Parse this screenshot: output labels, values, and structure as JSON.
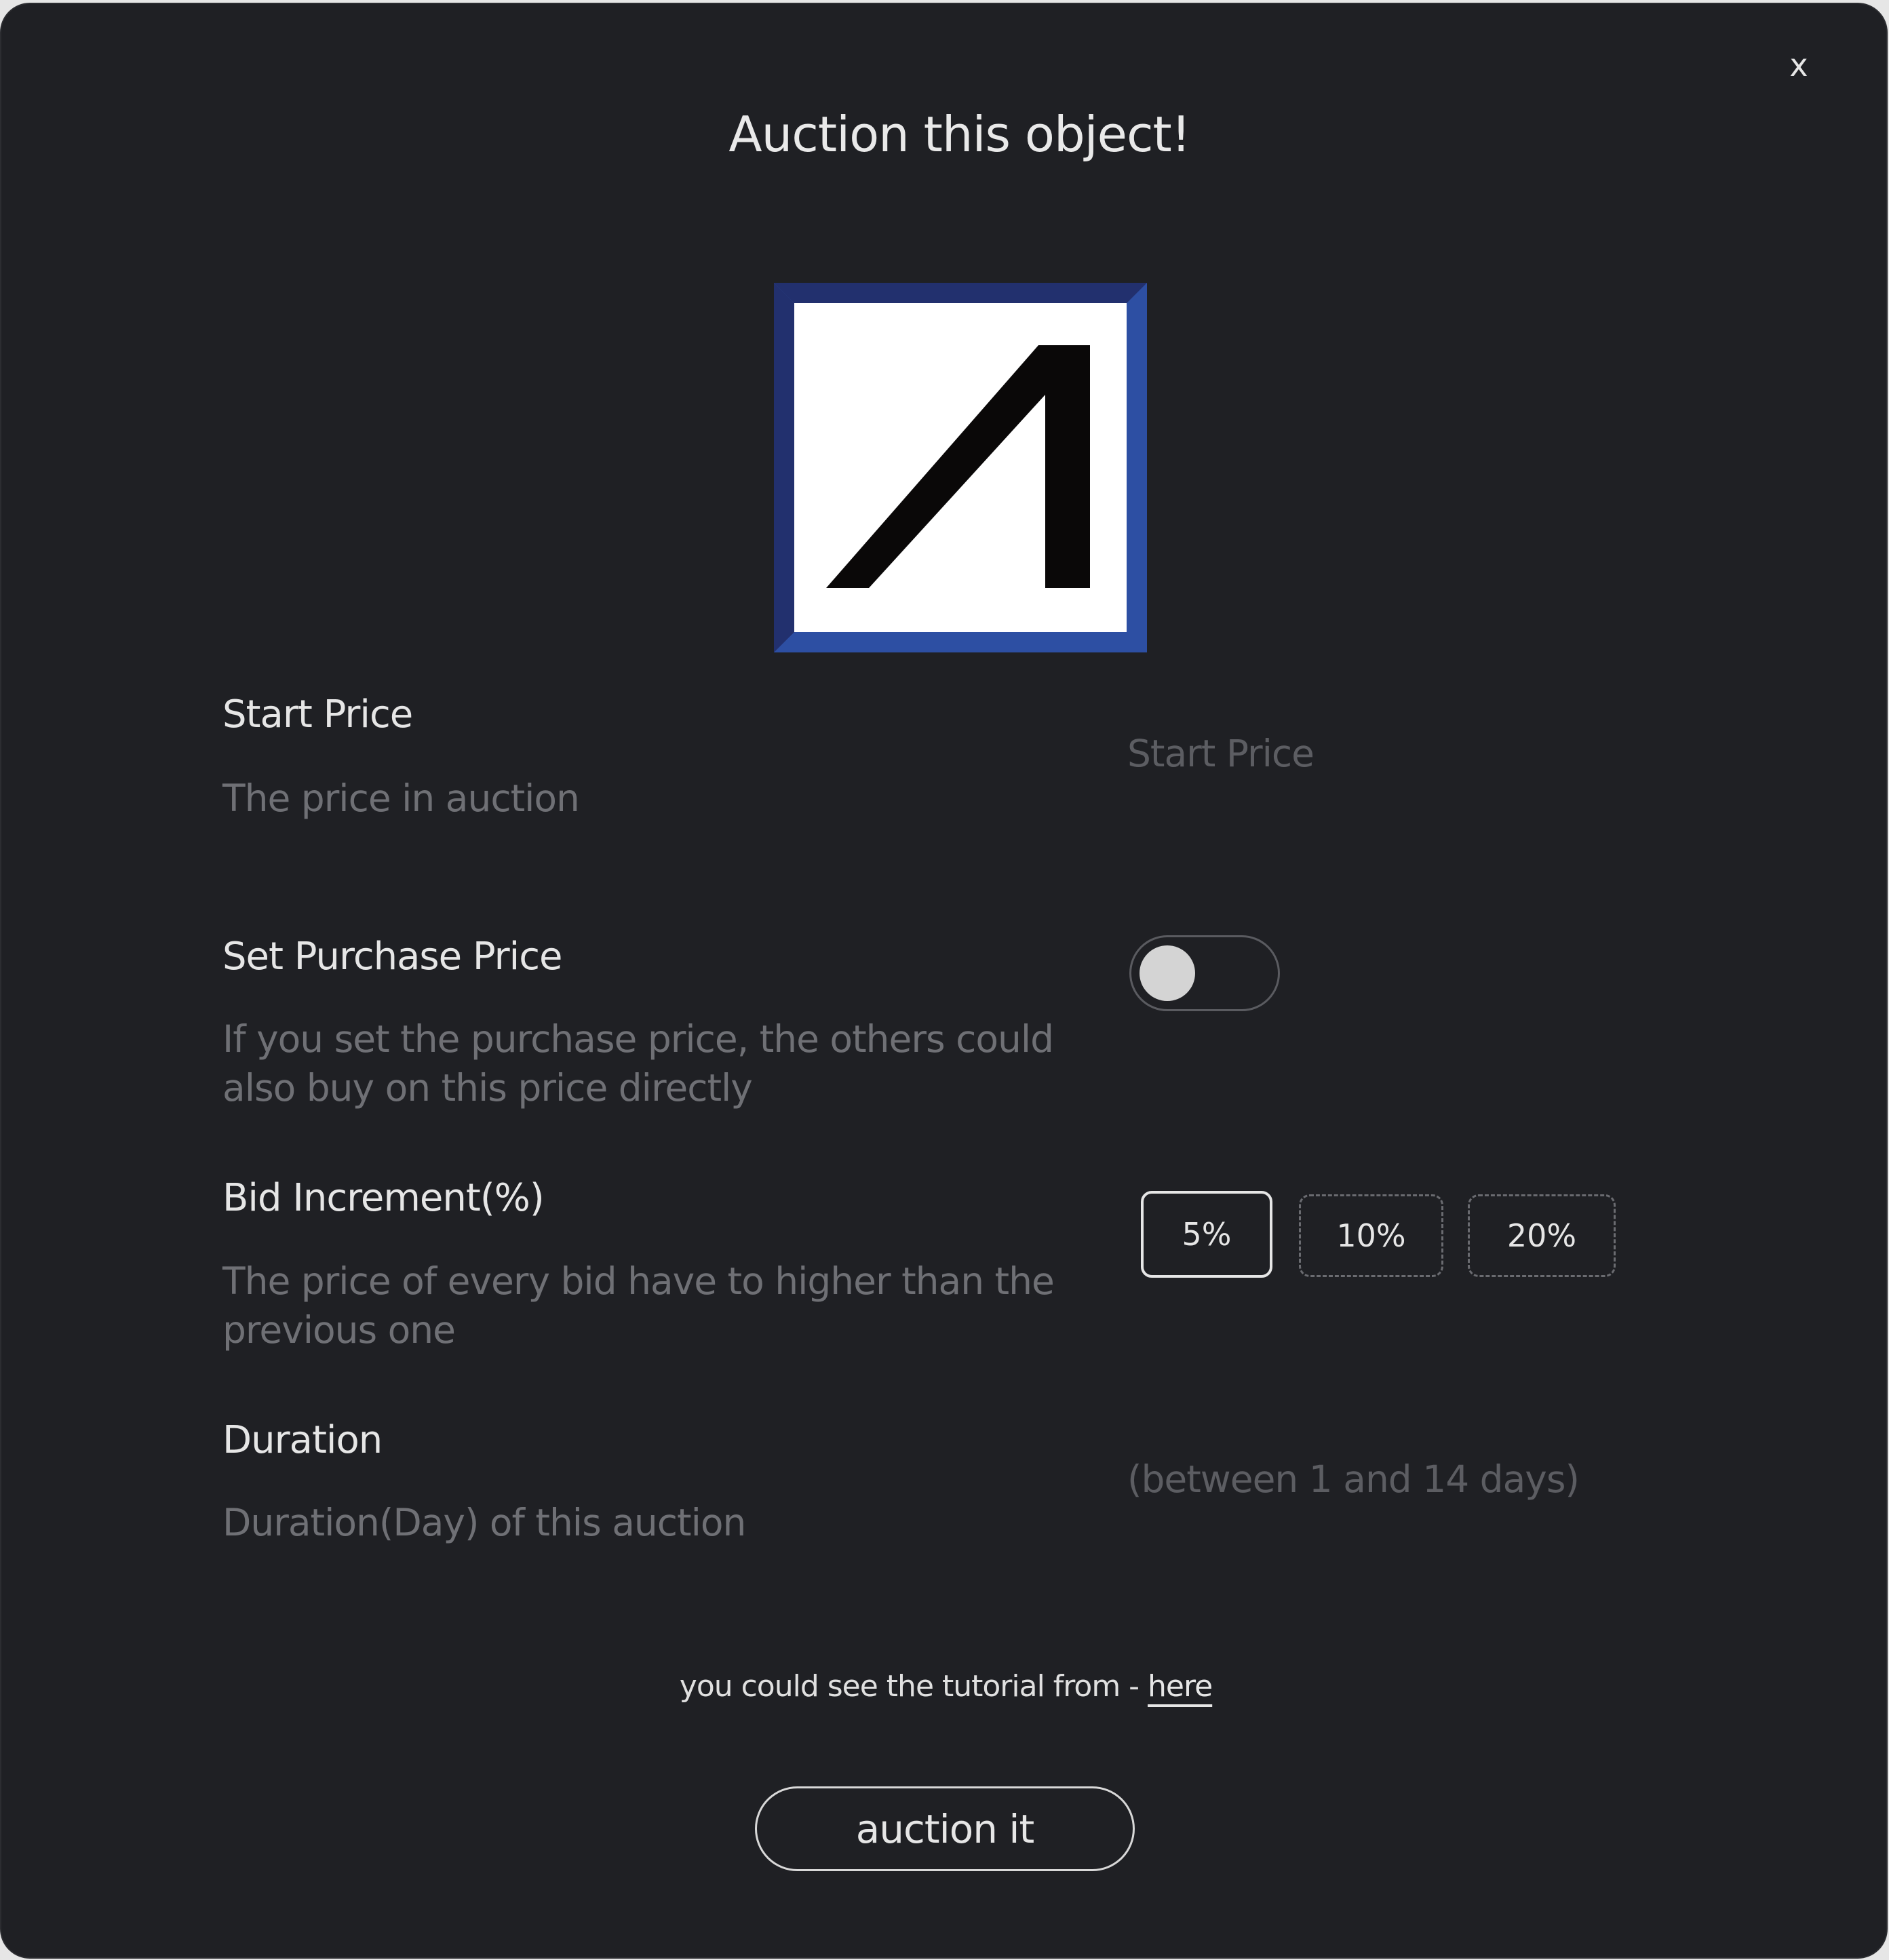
{
  "dialog": {
    "title": "Auction this object!",
    "close_label": "x"
  },
  "fields": {
    "start_price": {
      "label": "Start Price",
      "description": "The price in auction",
      "placeholder": "Start Price",
      "value": ""
    },
    "purchase_price": {
      "label": "Set Purchase Price",
      "description": "If you set the purchase price, the others could also buy on this price directly",
      "enabled": false
    },
    "bid_increment": {
      "label": "Bid Increment(%)",
      "description": "The price of every bid have to higher than the previous one",
      "options": [
        "5%",
        "10%",
        "20%"
      ],
      "selected": "5%"
    },
    "duration": {
      "label": "Duration",
      "description": "Duration(Day) of this auction",
      "placeholder": "(between 1 and 14 days)",
      "value": ""
    }
  },
  "tutorial": {
    "text": "you could see the tutorial from - ",
    "link_label": "here"
  },
  "submit_label": "auction it",
  "colors": {
    "background": "#1f2024",
    "logo_frame": "#22306e",
    "logo_bevel": "#2d4fa3",
    "logo_inner": "#ffffff",
    "logo_mark": "#0a0808"
  }
}
